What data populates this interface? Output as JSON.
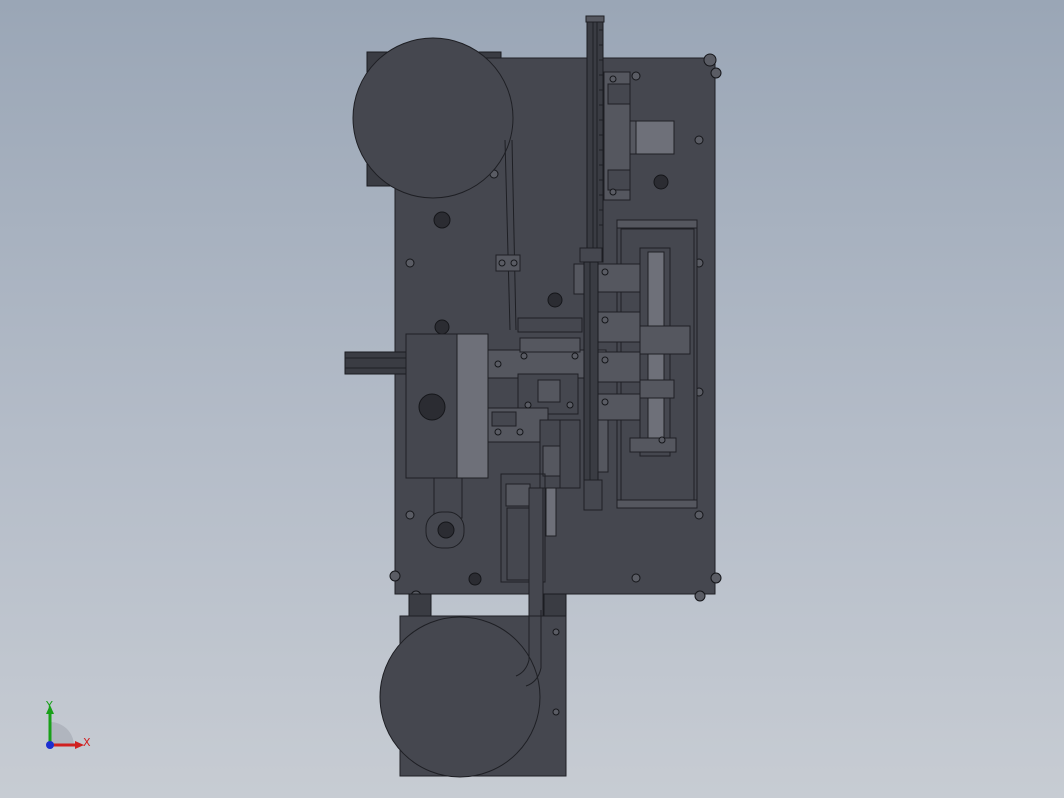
{
  "view": {
    "background_top": "#9aa6b6",
    "background_bottom": "#c7ccd3",
    "part_color": "#45474f",
    "edge_color": "#1e1f24",
    "highlight_color": "#6e7079"
  },
  "triad": {
    "x_label": "X",
    "y_label": "Y",
    "x_color": "#d02020",
    "y_color": "#18a018",
    "z_color": "#1c2fd0"
  }
}
